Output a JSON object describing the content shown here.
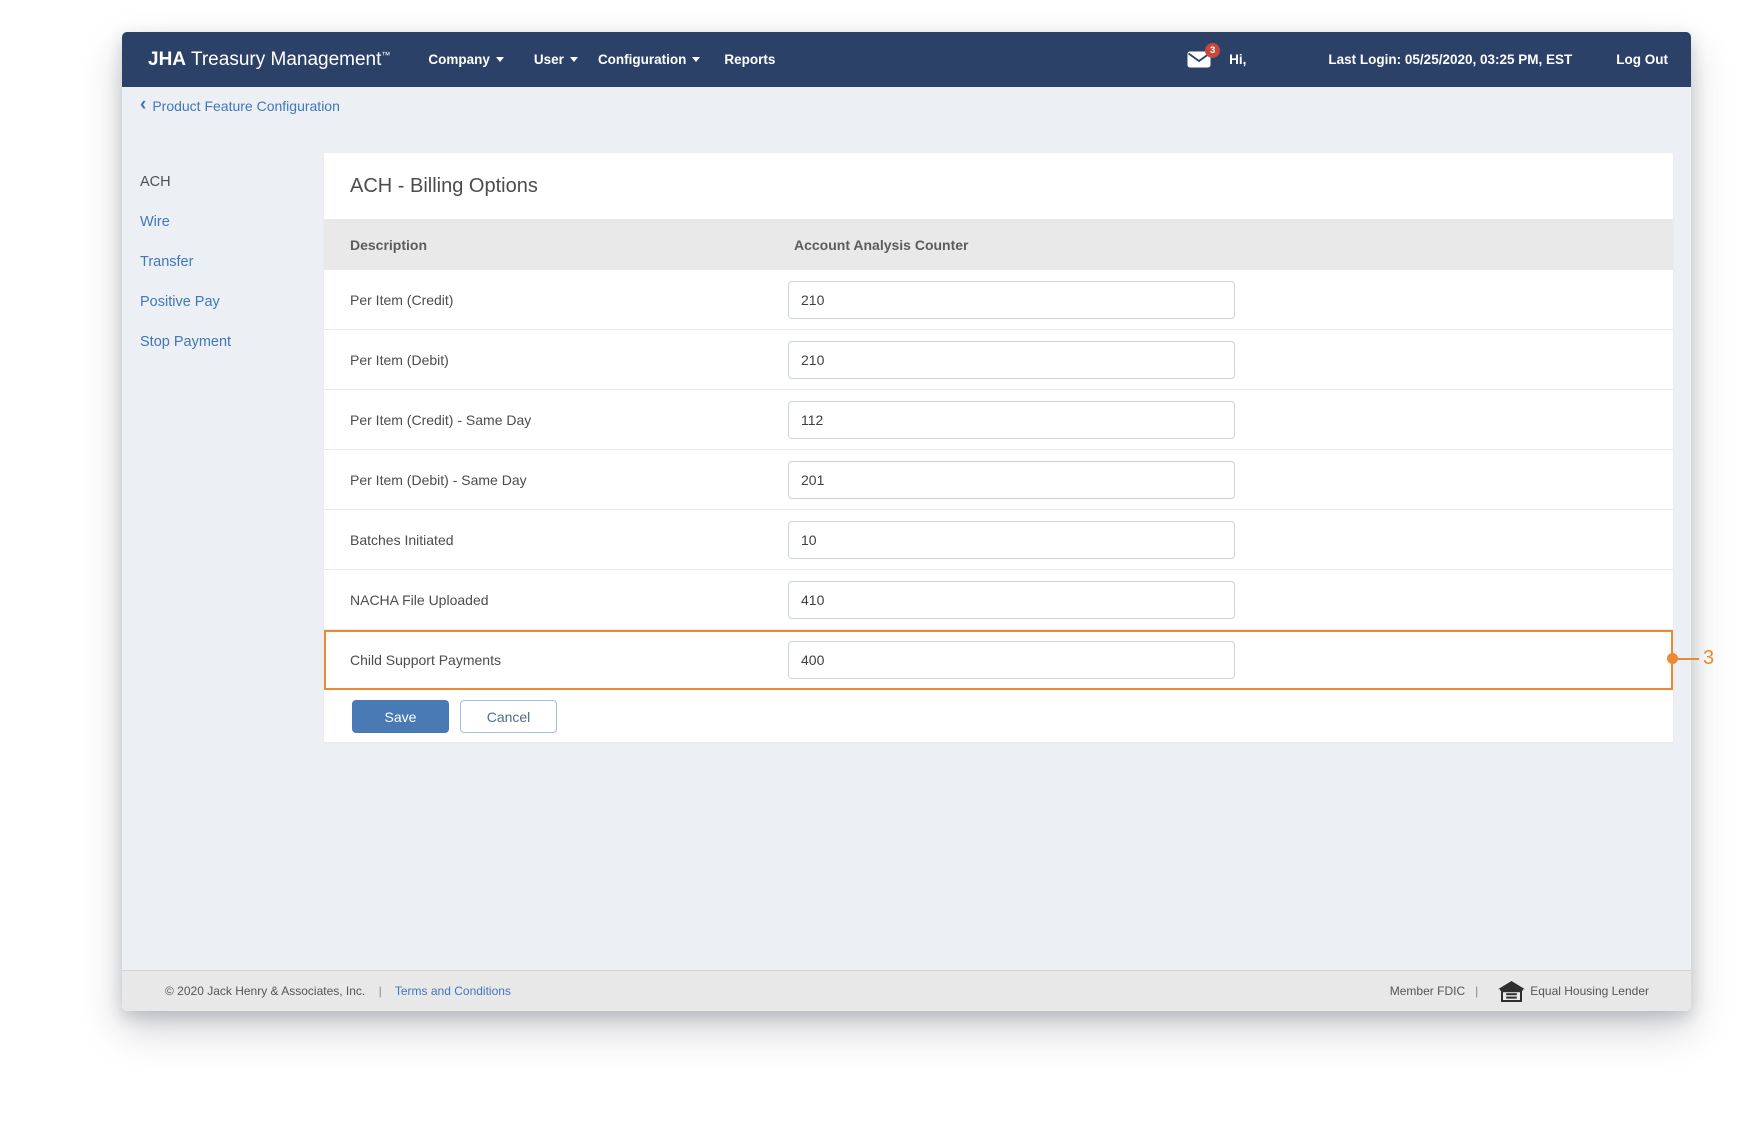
{
  "navbar": {
    "brand_bold": "JHA",
    "brand_rest": " Treasury Management",
    "brand_tm": "™",
    "menu": {
      "company": "Company",
      "user": "User",
      "configuration": "Configuration",
      "reports": "Reports"
    },
    "badge_count": "3",
    "greeting": "Hi,",
    "last_login": "Last Login: 05/25/2020, 03:25 PM, EST",
    "log_out": "Log Out"
  },
  "breadcrumb": {
    "chevron": "‹",
    "label": "Product Feature Configuration"
  },
  "sidebar": {
    "items": [
      {
        "label": "ACH",
        "active": true
      },
      {
        "label": "Wire",
        "active": false
      },
      {
        "label": "Transfer",
        "active": false
      },
      {
        "label": "Positive Pay",
        "active": false
      },
      {
        "label": "Stop Payment",
        "active": false
      }
    ]
  },
  "panel": {
    "title": "ACH - Billing Options",
    "columns": {
      "description": "Description",
      "counter": "Account Analysis Counter"
    },
    "rows": [
      {
        "description": "Per Item (Credit)",
        "value": "210"
      },
      {
        "description": "Per Item (Debit)",
        "value": "210"
      },
      {
        "description": "Per Item (Credit) - Same Day",
        "value": "112"
      },
      {
        "description": "Per Item (Debit) - Same Day",
        "value": "201"
      },
      {
        "description": "Batches Initiated",
        "value": "10"
      },
      {
        "description": "NACHA File Uploaded",
        "value": "410"
      },
      {
        "description": "Child Support Payments",
        "value": "400"
      }
    ],
    "highlighted_row": "Child Support Payments",
    "callout_label": "3",
    "buttons": {
      "save": "Save",
      "cancel": "Cancel"
    }
  },
  "footer": {
    "copyright": "© 2020 Jack Henry & Associates, Inc.",
    "separator": "|",
    "terms": "Terms and Conditions",
    "member_fdic": "Member FDIC",
    "equal_housing": "Equal Housing Lender"
  },
  "colors": {
    "navbar_navy": "#2c4167",
    "link_blue": "#4077bb",
    "highlight_orange": "#ec8a33",
    "badge_red": "#c9483d",
    "save_blue": "#4a7ab4",
    "content_bg": "#eceff3",
    "header_gray": "#e9e9e9",
    "footer_gray": "#e8e8e8"
  }
}
